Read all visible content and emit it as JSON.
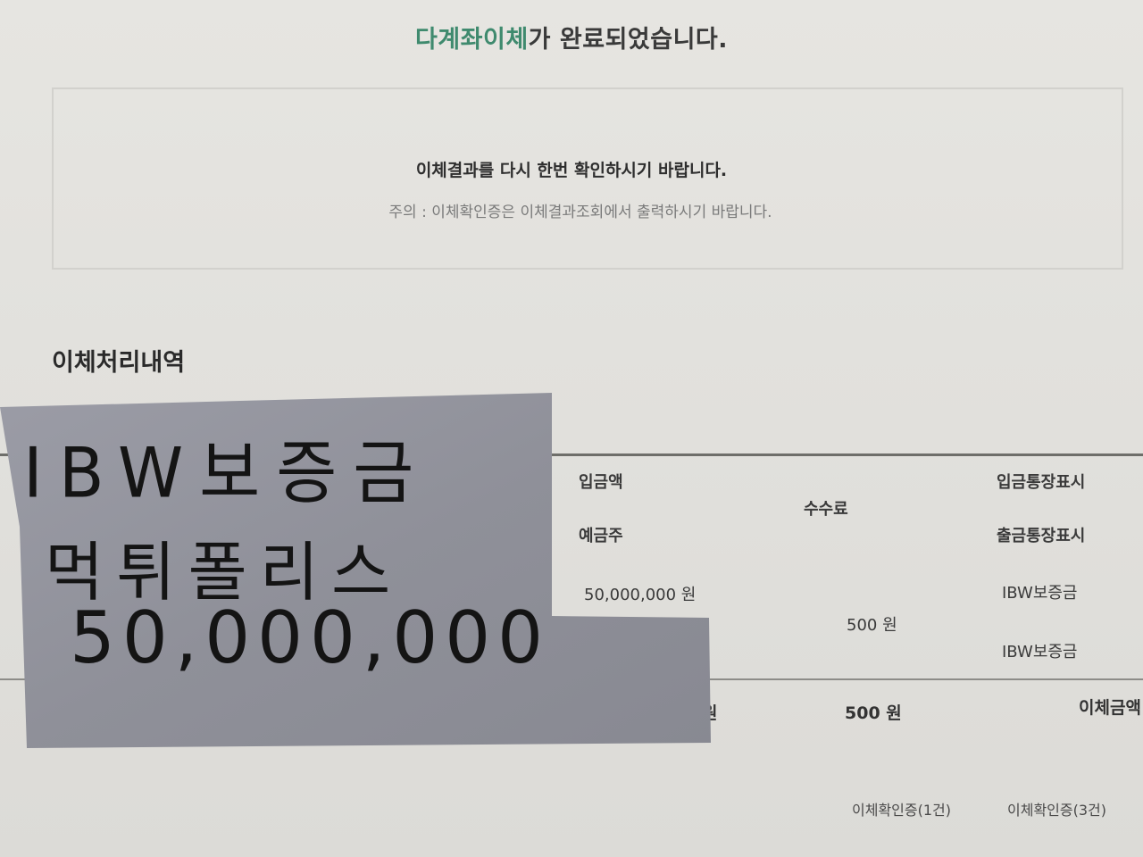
{
  "header": {
    "title_accent": "다계좌이체",
    "title_rest": "가 완료되었습니다."
  },
  "confirm": {
    "message": "이체결과를 다시 한번 확인하시기 바랍니다.",
    "note": "주의 : 이체확인증은 이체결과조회에서 출력하시기 바랍니다."
  },
  "section": {
    "title": "이체처리내역"
  },
  "table": {
    "headers": {
      "deposit_amount": "입금액",
      "account_holder": "예금주",
      "fee": "수수료",
      "deposit_memo": "입금통장표시",
      "withdraw_memo": "출금통장표시"
    },
    "row": {
      "deposit_amount": "50,000,000 원",
      "fee": "500 원",
      "deposit_memo": "IBW보증금",
      "withdraw_memo": "IBW보증금"
    },
    "totals": {
      "amount_suffix": "원",
      "fee": "500 원",
      "label": "이체금액"
    }
  },
  "footer": {
    "btn_certificate_1": "이체확인증(1건)",
    "btn_certificate_3": "이체확인증(3건)"
  },
  "sticky_note": {
    "line1": "IBW보증금",
    "line2": "먹튀폴리스",
    "line3": "50,000,000"
  }
}
